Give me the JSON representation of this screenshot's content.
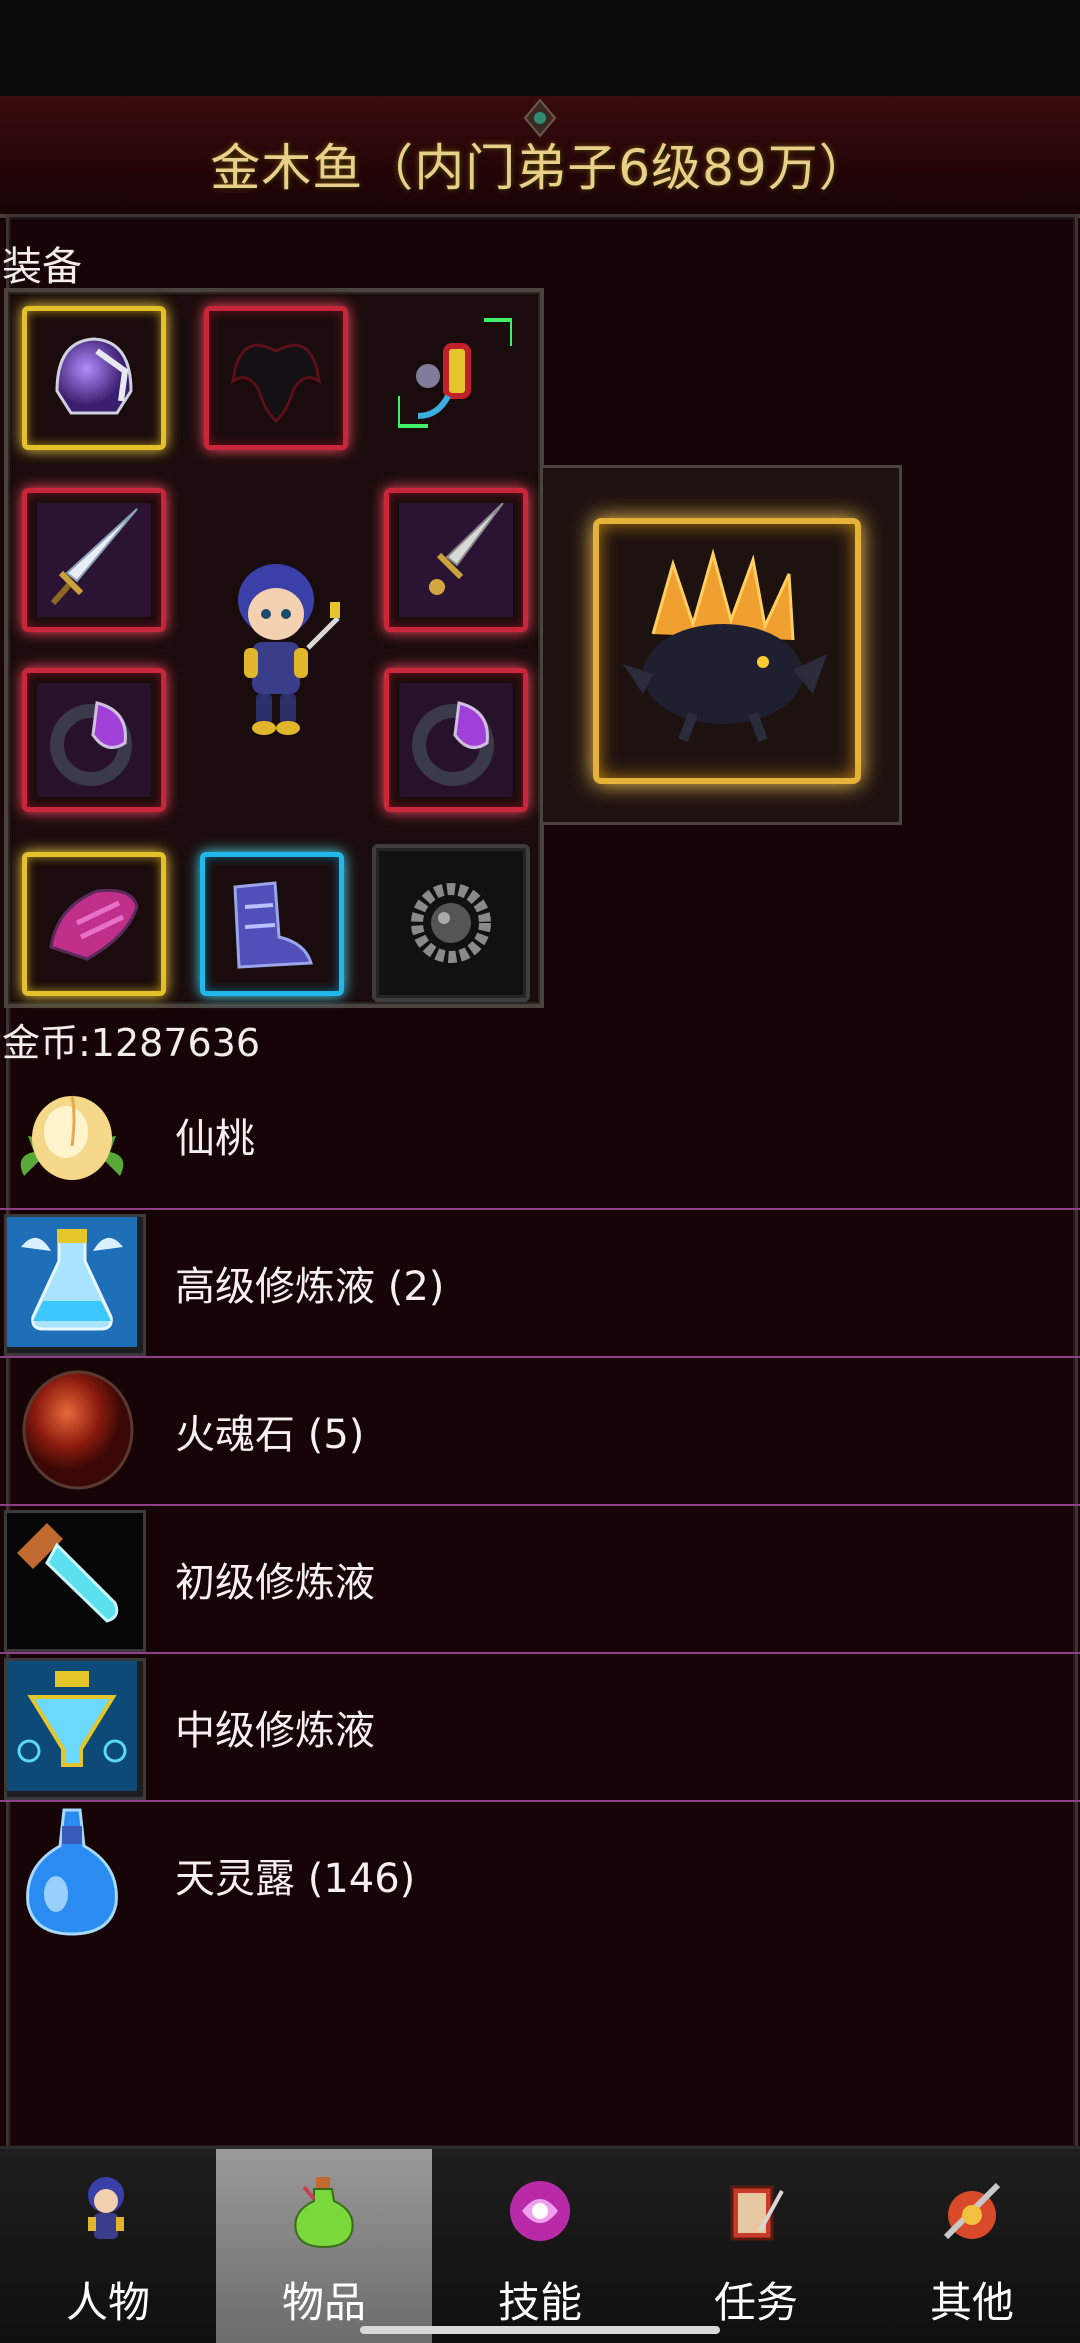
{
  "header": {
    "title": "金木鱼（内门弟子6级89万）"
  },
  "equipment": {
    "label": "装备",
    "slots": [
      {
        "icon": "helmet-icon",
        "rarity": "gold"
      },
      {
        "icon": "wings-icon",
        "rarity": "red"
      },
      {
        "icon": "pendant-icon",
        "rarity": "green"
      },
      {
        "icon": "sword-icon",
        "rarity": "red"
      },
      {
        "icon": "dagger-icon",
        "rarity": "red"
      },
      {
        "icon": "ring-icon",
        "rarity": "red"
      },
      {
        "icon": "ring-icon",
        "rarity": "red"
      },
      {
        "icon": "gloves-icon",
        "rarity": "gold"
      },
      {
        "icon": "boots-icon",
        "rarity": "cyan"
      },
      {
        "icon": "beads-icon",
        "rarity": "plain"
      }
    ],
    "pet": {
      "icon": "dragon-pet-icon",
      "rarity": "gold"
    }
  },
  "currency": {
    "gold_text": "金币:1287636"
  },
  "inventory": [
    {
      "icon": "peach-icon",
      "label": "仙桃"
    },
    {
      "icon": "advanced-potion-icon",
      "label": "高级修炼液 (2)"
    },
    {
      "icon": "fire-stone-icon",
      "label": "火魂石 (5)"
    },
    {
      "icon": "basic-potion-icon",
      "label": "初级修炼液"
    },
    {
      "icon": "intermediate-potion-icon",
      "label": "中级修炼液"
    },
    {
      "icon": "spirit-dew-icon",
      "label": "天灵露 (146)"
    }
  ],
  "nav": {
    "tabs": [
      {
        "label": "人物",
        "icon": "character-icon"
      },
      {
        "label": "物品",
        "icon": "items-icon",
        "active": true
      },
      {
        "label": "技能",
        "icon": "skills-icon"
      },
      {
        "label": "任务",
        "icon": "quests-icon"
      },
      {
        "label": "其他",
        "icon": "other-icon"
      }
    ]
  },
  "colors": {
    "background": "#160406",
    "title_gold": "#e9d08a",
    "row_divider": "#8e3f87",
    "active_tab": "#8a8a8a"
  }
}
